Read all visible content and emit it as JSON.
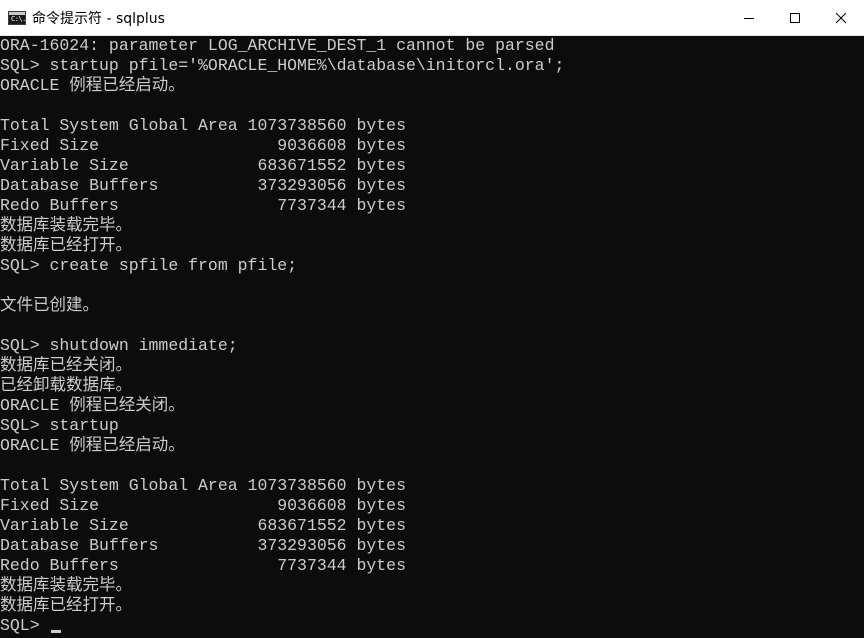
{
  "window": {
    "title": "命令提示符 - sqlplus",
    "icon_label": "C:\\."
  },
  "controls": {
    "minimize": "minimize-icon",
    "maximize": "maximize-icon",
    "close": "close-icon"
  },
  "console": {
    "lines": [
      "ORA-16024: parameter LOG_ARCHIVE_DEST_1 cannot be parsed",
      "SQL> startup pfile='%ORACLE_HOME%\\database\\initorcl.ora';",
      "ORACLE 例程已经启动。",
      "",
      "Total System Global Area 1073738560 bytes",
      "Fixed Size                  9036608 bytes",
      "Variable Size             683671552 bytes",
      "Database Buffers          373293056 bytes",
      "Redo Buffers                7737344 bytes",
      "数据库装载完毕。",
      "数据库已经打开。",
      "SQL> create spfile from pfile;",
      "",
      "文件已创建。",
      "",
      "SQL> shutdown immediate;",
      "数据库已经关闭。",
      "已经卸载数据库。",
      "ORACLE 例程已经关闭。",
      "SQL> startup",
      "ORACLE 例程已经启动。",
      "",
      "Total System Global Area 1073738560 bytes",
      "Fixed Size                  9036608 bytes",
      "Variable Size             683671552 bytes",
      "Database Buffers          373293056 bytes",
      "Redo Buffers                7737344 bytes",
      "数据库装载完毕。",
      "数据库已经打开。"
    ],
    "prompt": "SQL> "
  },
  "colors": {
    "background": "#0c0c0c",
    "foreground": "#cccccc",
    "titlebar": "#ffffff"
  }
}
